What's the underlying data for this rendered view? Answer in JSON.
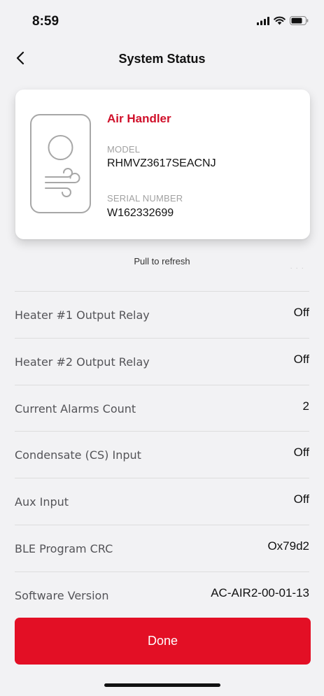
{
  "status_bar": {
    "time": "8:59",
    "icons": [
      "cellular-signal-icon",
      "wifi-icon",
      "battery-icon"
    ]
  },
  "nav": {
    "title": "System Status",
    "back_icon": "chevron-left-icon"
  },
  "device": {
    "name": "Air Handler",
    "model_label": "MODEL",
    "model_value": "RHMVZ3617SEACNJ",
    "serial_label": "SERIAL NUMBER",
    "serial_value": "W162332699",
    "icon": "air-handler-icon"
  },
  "refresh": {
    "text": "Pull to refresh"
  },
  "rows": [
    {
      "label": "Heater #1 Output Relay",
      "value": "Off"
    },
    {
      "label": "Heater #2 Output Relay",
      "value": "Off"
    },
    {
      "label": "Current Alarms Count",
      "value": "2"
    },
    {
      "label": "Condensate (CS) Input",
      "value": "Off"
    },
    {
      "label": "Aux Input",
      "value": "Off"
    },
    {
      "label": "BLE Program CRC",
      "value": "Ox79d2"
    },
    {
      "label": "Software Version",
      "value": "AC-AIR2-00-01-13"
    }
  ],
  "footer": {
    "done_label": "Done"
  },
  "colors": {
    "accent": "#e30f25",
    "device_name": "#d0102a",
    "background": "#f2f2f4"
  }
}
